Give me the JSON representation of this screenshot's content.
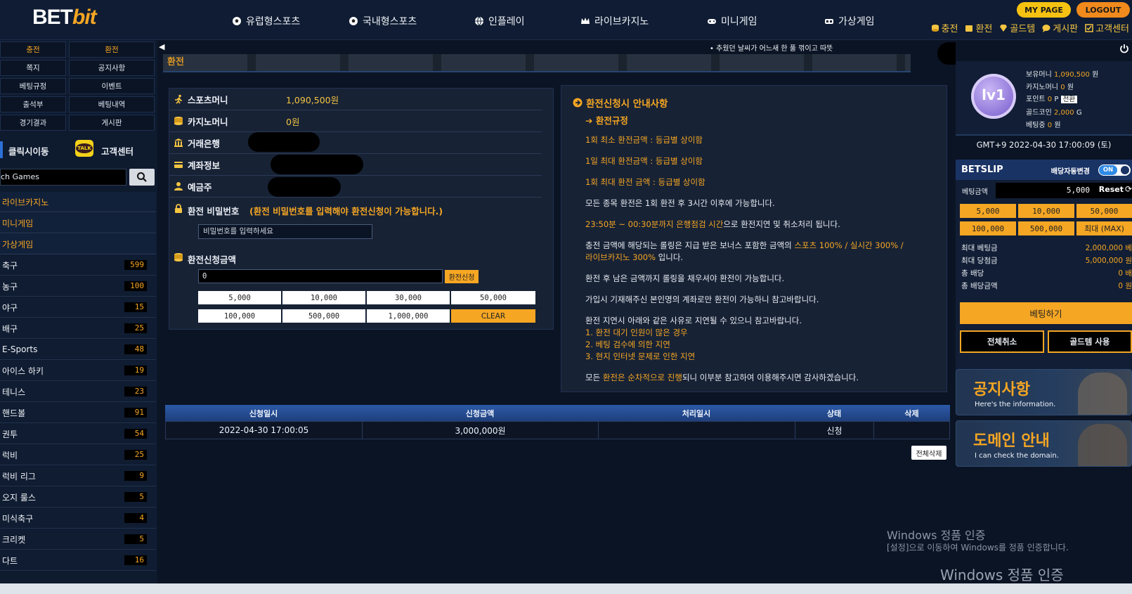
{
  "header": {
    "logo_part1": "BET",
    "logo_part2": "bit",
    "nav": [
      {
        "label": "유럽형스포츠",
        "icon": "soccer-ball-icon"
      },
      {
        "label": "국내형스포츠",
        "icon": "soccer-ball-icon"
      },
      {
        "label": "인플레이",
        "icon": "globe-icon"
      },
      {
        "label": "라이브카지노",
        "icon": "crown-icon"
      },
      {
        "label": "미니게임",
        "icon": "gamepad-icon"
      },
      {
        "label": "가상게임",
        "icon": "vr-headset-icon"
      }
    ],
    "mypage": "MY PAGE",
    "logout": "LOGOUT",
    "links": [
      "충전",
      "환전",
      "골드템",
      "게시판",
      "고객센터"
    ]
  },
  "sidebar": {
    "quick": [
      [
        "충전",
        "환전"
      ],
      [
        "쪽지",
        "공지사항"
      ],
      [
        "베팅규정",
        "이벤트"
      ],
      [
        "출석부",
        "베팅내역"
      ],
      [
        "경기결과",
        "게시판"
      ]
    ],
    "click_move": "클릭시이동",
    "customer_center": "고객센터",
    "talk": "TALK",
    "search_value": "ch Games",
    "categories": [
      "라이브카지노",
      "미니게임",
      "가상게임"
    ],
    "sports": [
      {
        "name": "축구",
        "count": "599"
      },
      {
        "name": "농구",
        "count": "100"
      },
      {
        "name": "야구",
        "count": "15"
      },
      {
        "name": "배구",
        "count": "25"
      },
      {
        "name": "E-Sports",
        "count": "48"
      },
      {
        "name": "아이스 하키",
        "count": "19"
      },
      {
        "name": "테니스",
        "count": "23"
      },
      {
        "name": "핸드볼",
        "count": "91"
      },
      {
        "name": "권투",
        "count": "54"
      },
      {
        "name": "럭비",
        "count": "25"
      },
      {
        "name": "럭비 리그",
        "count": "9"
      },
      {
        "name": "오지 룰스",
        "count": "5"
      },
      {
        "name": "미식축구",
        "count": "4"
      },
      {
        "name": "크리켓",
        "count": "5"
      },
      {
        "name": "다트",
        "count": "16"
      }
    ]
  },
  "main": {
    "marquee": "• 추웠던 날씨가 어느새 한 풀 꺾이고 따뜻",
    "page_title_stub": "환전",
    "form": {
      "sports_money_label": "스포츠머니",
      "sports_money_value": "1,090,500원",
      "casino_money_label": "카지노머니",
      "casino_money_value": "0원",
      "bank_label": "거래은행",
      "account_label": "계좌정보",
      "holder_label": "예금주",
      "password_label": "환전 비밀번호",
      "password_note": "(환전 비밀번호를 입력해야 환전신청이 가능합니다.)",
      "password_placeholder": "비밀번호를 입력하세요",
      "amount_label": "환전신청금액",
      "amount_value": "0",
      "apply_button": "환전신청",
      "amounts_row1": [
        "5,000",
        "10,000",
        "30,000",
        "50,000"
      ],
      "amounts_row2": [
        "100,000",
        "500,000",
        "1,000,000"
      ],
      "clear": "CLEAR"
    },
    "info": {
      "title": "환전신청시 안내사항",
      "subtitle": "환전규정",
      "rule1": "1회 최소 환전금액 : 등급별 상이함",
      "rule2": "1일 최대 환전금액 : 등급별 상이함",
      "rule3": "1회 최대 환전 금액 : 등급별 상이함",
      "p1": "모든 종목 환전은 1회 환전 후 3시간 이후에 가능합니다.",
      "p2_hl": "23:50분 ~ 00:30분까지 은행점검 시간",
      "p2_rest": "으로 환전지연 및 취소처리 됩니다.",
      "p3_a": "충전 금액에 해당되는 롤링은 지급 받은 보너스 포함한 금액의 ",
      "p3_hl1": "스포츠 100% / 실시간 300% /",
      "p3_hl2": "라이브카지노 300%",
      "p3_b": " 입니다.",
      "p4": "환전 후 남은 금액까지 롤링을 채우셔야 환전이 가능합니다.",
      "p5": "가입시 기재해주신 본인명의 계좌로만 환전이 가능하니 참고바랍니다.",
      "p6": "환전 지연시 아래와 같은 사유로 지연될 수 있으니 참고바랍니다.",
      "r1": "1. 환전 대기 인원이 많은 경우",
      "r2": "2. 베팅 검수에 의한 지연",
      "r3": "3. 현지 인터넷 문제로 인한 지연",
      "p7_a": "모든 ",
      "p7_hl": "환전은 순차적으로 진행",
      "p7_b": "되니 이부분 참고하여 이용해주시면 감사하겠습니다."
    },
    "table": {
      "headers": [
        "신청일시",
        "신청금액",
        "처리일시",
        "상태",
        "삭제"
      ],
      "rows": [
        {
          "date": "2022-04-30 17:00:05",
          "amount": "3,000,000원",
          "processed": "",
          "status": "신청",
          "delete": ""
        }
      ],
      "delete_all": "전체삭제"
    }
  },
  "right": {
    "level": "lv1",
    "holdings_label": "보유머니",
    "holdings_value": "1,090,500",
    "holdings_unit": "원",
    "casino_label": "카지노머니",
    "casino_value": "0",
    "casino_unit": "원",
    "point_label": "포인트",
    "point_value": "0",
    "point_unit": "P",
    "convert": "전환",
    "gold_label": "골드코인",
    "gold_value": "2,000",
    "gold_unit": "G",
    "betting_label": "베팅중",
    "betting_value": "0",
    "betting_unit": "원",
    "clock": "GMT+9 2022-04-30 17:00:09 (토)",
    "betslip": "BETSLIP",
    "auto_change": "배당자동변경",
    "toggle": "ON",
    "bet_amount_label": "베팅금액",
    "bet_amount_value": "5,000",
    "reset": "Reset",
    "amounts": [
      "5,000",
      "10,000",
      "50,000",
      "100,000",
      "500,000",
      "최대 (MAX)"
    ],
    "max_bet_label": "최대 베팅금",
    "max_bet_value": "2,000,000 베",
    "max_win_label": "최대 당첨금",
    "max_win_value": "5,000,000 원",
    "total_odds_label": "총 배당",
    "total_odds_value": "0 배",
    "total_amt_label": "총 배당금액",
    "total_amt_value": "0 원",
    "bet_button": "베팅하기",
    "cancel_all": "전체취소",
    "goldtem": "골드템 사용",
    "notice_title": "공지사항",
    "notice_sub": "Here's the information.",
    "domain_title": "도메인 안내",
    "domain_sub": "I can check the domain."
  },
  "watermark": {
    "title": "Windows 정품 인증",
    "sub": "[설정]으로 이동하여 Windows를 정품 인증합니다.",
    "title2": "Windows 정품 인증"
  }
}
